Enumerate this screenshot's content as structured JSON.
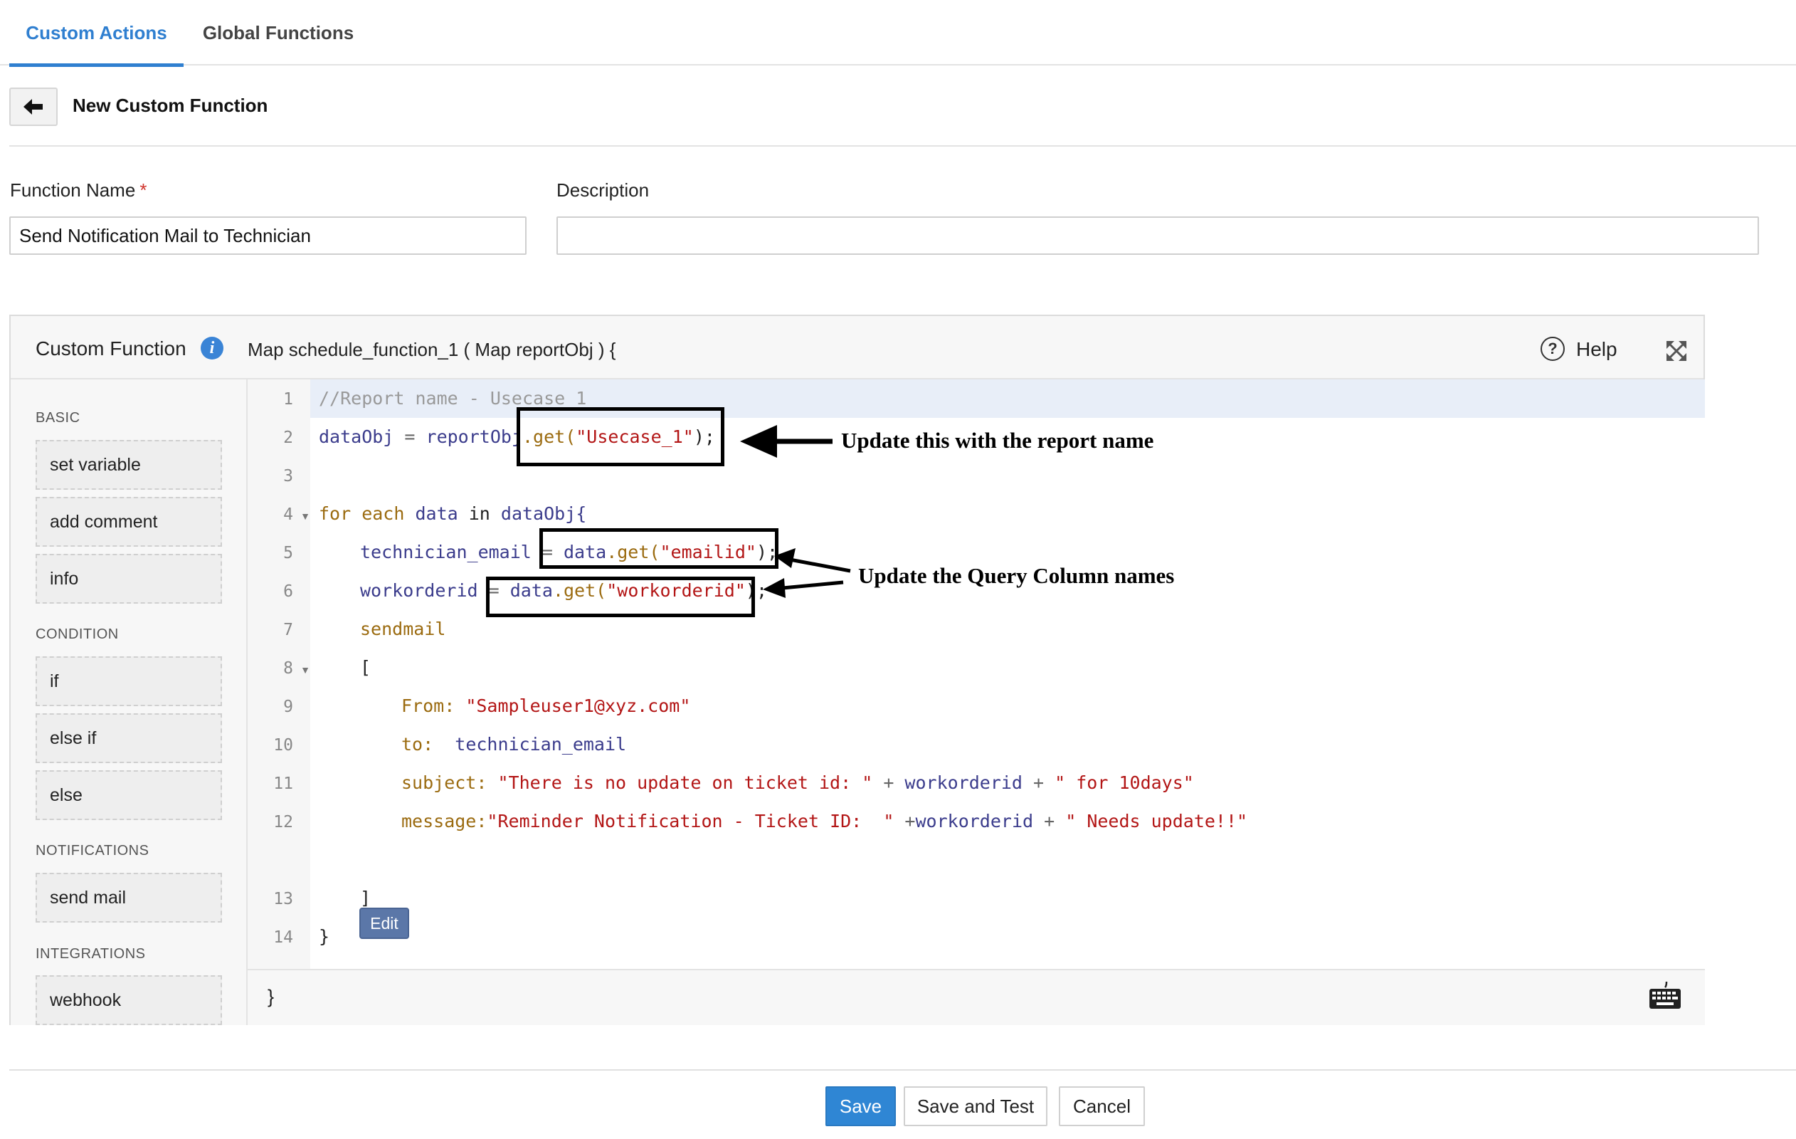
{
  "tabs": [
    {
      "label": "Custom Actions",
      "active": true
    },
    {
      "label": "Global Functions",
      "active": false
    }
  ],
  "header": {
    "title": "New Custom Function",
    "back_icon": "arrow-left-icon"
  },
  "form": {
    "function_name_label": "Function Name",
    "required_marker": "*",
    "function_name_value": "Send Notification Mail to Technician",
    "description_label": "Description",
    "description_value": ""
  },
  "editor": {
    "title": "Custom Function",
    "signature": "Map schedule_function_1 ( Map reportObj ) {",
    "help_label": "Help",
    "closing_brace": "}",
    "edit_label": "Edit",
    "sidebar": {
      "sections": [
        {
          "label": "BASIC",
          "items": [
            "set variable",
            "add comment",
            "info"
          ]
        },
        {
          "label": "CONDITION",
          "items": [
            "if",
            "else if",
            "else"
          ]
        },
        {
          "label": "NOTIFICATIONS",
          "items": [
            "send mail"
          ]
        },
        {
          "label": "INTEGRATIONS",
          "items": [
            "webhook"
          ]
        }
      ]
    },
    "line_numbers": [
      "1",
      "2",
      "3",
      "4",
      "5",
      "6",
      "7",
      "8",
      "9",
      "10",
      "11",
      "12",
      "13",
      "14"
    ],
    "code": {
      "l1": "//Report name - Usecase_1",
      "l2_a": "dataObj",
      "l2_b": " = ",
      "l2_c": "reportObj",
      "l2_d": ".get(",
      "l2_e": "\"Usecase_1\"",
      "l2_f": ");",
      "l4_a": "for each ",
      "l4_b": "data",
      "l4_c": " in ",
      "l4_d": "dataObj{",
      "l5_a": "technician_email",
      "l5_b": " = ",
      "l5_c": "data",
      "l5_d": ".get(",
      "l5_e": "\"emailid\"",
      "l5_f": ");",
      "l6_a": "workorderid",
      "l6_b": " = ",
      "l6_c": "data",
      "l6_d": ".get(",
      "l6_e": "\"workorderid\"",
      "l6_f": ");",
      "l7": "sendmail",
      "l8": "[",
      "l9_a": "From: ",
      "l9_b": "\"Sampleuser1@xyz.com\"",
      "l10_a": "to:  ",
      "l10_b": "technician_email",
      "l11_a": "subject: ",
      "l11_b": "\"There is no update on ticket id: \"",
      "l11_c": " + ",
      "l11_d": "workorderid",
      "l11_e": " + ",
      "l11_f": "\" for 10days\"",
      "l12_a": "message:",
      "l12_b": "\"Reminder Notification - Ticket ID:  \"",
      "l12_c": " +",
      "l12_d": "workorderid",
      "l12_e": " + ",
      "l12_f": "\" Needs update!!\"",
      "l13": "]",
      "l14": "}"
    }
  },
  "annotations": {
    "report_name": "Update this with the report name",
    "query_columns": "Update the Query Column names"
  },
  "buttons": {
    "save": "Save",
    "save_and_test": "Save and Test",
    "cancel": "Cancel"
  },
  "colors": {
    "accent": "#2f7fd0",
    "primary_button": "#2f86d4",
    "edit_button": "#5b77a8",
    "string": "#b31616",
    "variable": "#3b3c8c",
    "keyword": "#9b6b10"
  },
  "icons": {
    "info": "info-icon",
    "help": "question-circle-icon",
    "expand": "expand-icon",
    "keyboard": "keyboard-icon"
  }
}
